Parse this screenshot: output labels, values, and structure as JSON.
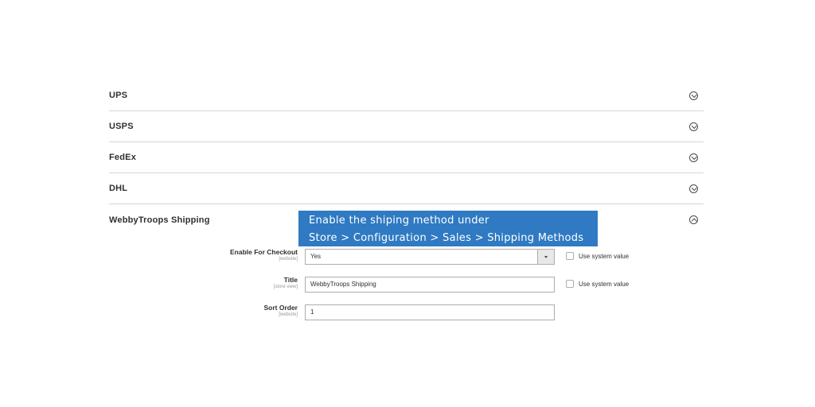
{
  "sections": [
    {
      "title": "UPS",
      "state": "collapsed",
      "icon": "chevron-down-circle-icon"
    },
    {
      "title": "USPS",
      "state": "collapsed",
      "icon": "chevron-down-circle-icon"
    },
    {
      "title": "FedEx",
      "state": "collapsed",
      "icon": "chevron-down-circle-icon"
    },
    {
      "title": "DHL",
      "state": "collapsed",
      "icon": "chevron-down-circle-icon"
    },
    {
      "title": "WebbyTroops Shipping",
      "state": "expanded",
      "icon": "chevron-up-circle-icon"
    }
  ],
  "tooltip": {
    "line1": "Enable the shiping method under",
    "line2": "Store > Configuration > Sales > Shipping Methods",
    "color": "#2f7ac2"
  },
  "fields": {
    "enable_checkout": {
      "label": "Enable For Checkout",
      "scope": "[website]",
      "value": "Yes",
      "use_system_label": "Use system value"
    },
    "title": {
      "label": "Title",
      "scope": "[store view]",
      "value": "WebbyTroops Shipping",
      "use_system_label": "Use system value"
    },
    "sort_order": {
      "label": "Sort Order",
      "scope": "[website]",
      "value": "1"
    }
  }
}
